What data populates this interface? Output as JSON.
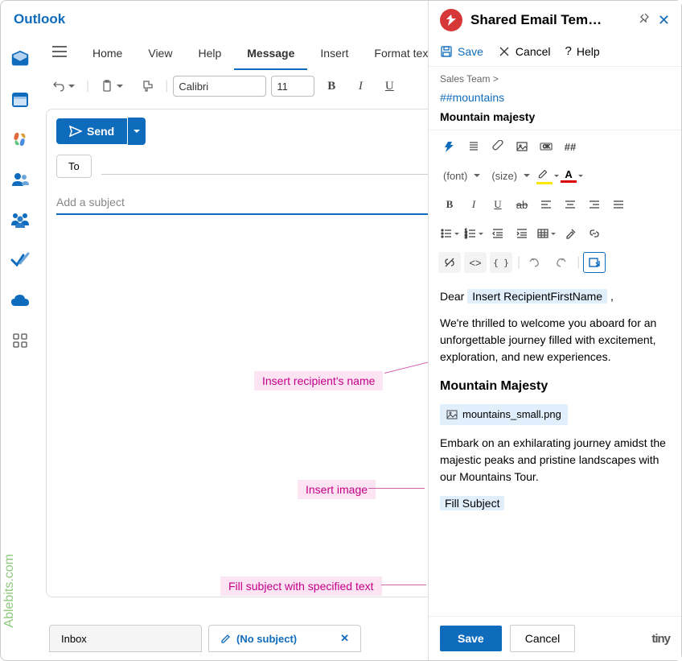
{
  "app_title": "Outlook",
  "titlebar": {
    "more": "⋯"
  },
  "ribbon": {
    "tabs": [
      "Home",
      "View",
      "Help",
      "Message",
      "Insert",
      "Format text"
    ],
    "active": "Message"
  },
  "toolbar": {
    "font": "Calibri",
    "size": "11"
  },
  "compose": {
    "send": "Send",
    "to": "To",
    "subject_placeholder": "Add a subject"
  },
  "callouts": {
    "c1": "Insert recipient's name",
    "c2": "Insert image",
    "c3": "Fill subject with specified text"
  },
  "bottom": {
    "inbox": "Inbox",
    "subject_tab": "(No subject)"
  },
  "panel": {
    "title": "Shared Email Tem…",
    "save": "Save",
    "cancel": "Cancel",
    "help": "Help",
    "breadcrumb": "Sales Team  >",
    "hashtag": "##mountains",
    "template_name": "Mountain majesty",
    "font_label": "(font)",
    "size_label": "(size)",
    "hash_btn": "##",
    "body": {
      "greeting": "Dear",
      "macro1": "Insert RecipientFirstName",
      "comma": ",",
      "p1": "We're thrilled to welcome you aboard for an unforgettable journey filled with excitement, exploration, and new experiences.",
      "h": "Mountain Majesty",
      "img": "mountains_small.png",
      "p2": "Embark on an exhilarating journey amidst the majestic peaks and pristine landscapes with our Mountains Tour.",
      "macro2": "Fill Subject"
    },
    "footer_save": "Save",
    "footer_cancel": "Cancel",
    "tiny": "tiny"
  },
  "watermark": "Ablebits.com"
}
